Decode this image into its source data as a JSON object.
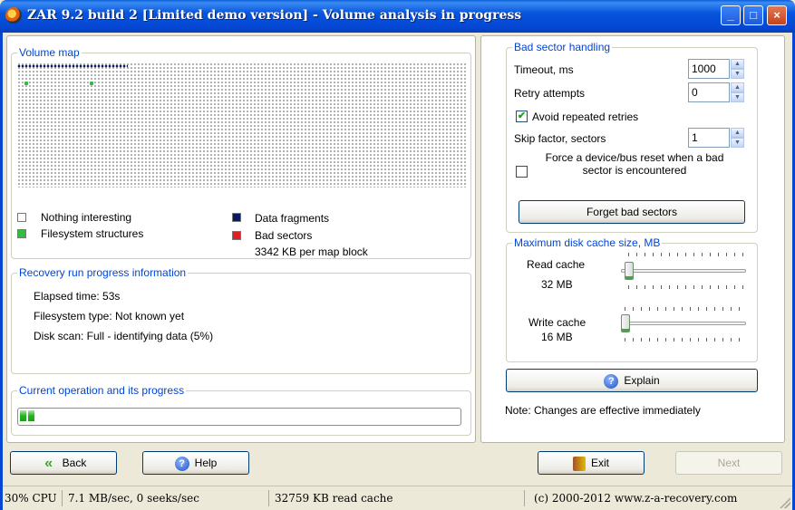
{
  "window": {
    "title": "ZAR 9.2 build 2 [Limited demo version] - Volume analysis in progress",
    "min_glyph": "_",
    "max_glyph": "□",
    "close_glyph": "×"
  },
  "volume_map": {
    "legend": "Volume map",
    "items": [
      {
        "label": "Nothing interesting",
        "color": "#ffffff"
      },
      {
        "label": "Filesystem structures",
        "color": "#2fbf3a"
      },
      {
        "label": "Data fragments",
        "color": "#0b1a5c"
      },
      {
        "label": "Bad sectors",
        "color": "#e02020"
      }
    ],
    "block_size_text": "3342 KB per map block"
  },
  "recovery": {
    "legend": "Recovery run progress information",
    "elapsed": "Elapsed time: 53s",
    "fs_type": "Filesystem type: Not known yet",
    "disk_scan": "Disk scan: Full - identifying data (5%)"
  },
  "current_op": {
    "legend": "Current operation and its progress",
    "progress_percent": 5
  },
  "bad_sector": {
    "legend": "Bad sector handling",
    "timeout_label": "Timeout, ms",
    "timeout_value": "1000",
    "retry_label": "Retry attempts",
    "retry_value": "0",
    "avoid_label": "Avoid repeated retries",
    "avoid_checked": true,
    "skip_label": "Skip factor, sectors",
    "skip_value": "1",
    "force_reset_label": "Force a device/bus reset when a bad sector is encountered",
    "force_reset_checked": false,
    "forget_button": "Forget bad sectors"
  },
  "cache": {
    "legend": "Maximum disk cache size, MB",
    "read_label": "Read cache",
    "read_value": "32 MB",
    "write_label": "Write cache",
    "write_value": "16 MB"
  },
  "explain_button": "Explain",
  "note": "Note: Changes are effective immediately",
  "nav": {
    "back": "Back",
    "help": "Help",
    "exit": "Exit",
    "next": "Next"
  },
  "status": {
    "cpu": "30% CPU",
    "throughput": "7.1 MB/sec, 0 seeks/sec",
    "cache": "32759 KB read cache",
    "copyright": "(c) 2000-2012 www.z-a-recovery.com"
  }
}
